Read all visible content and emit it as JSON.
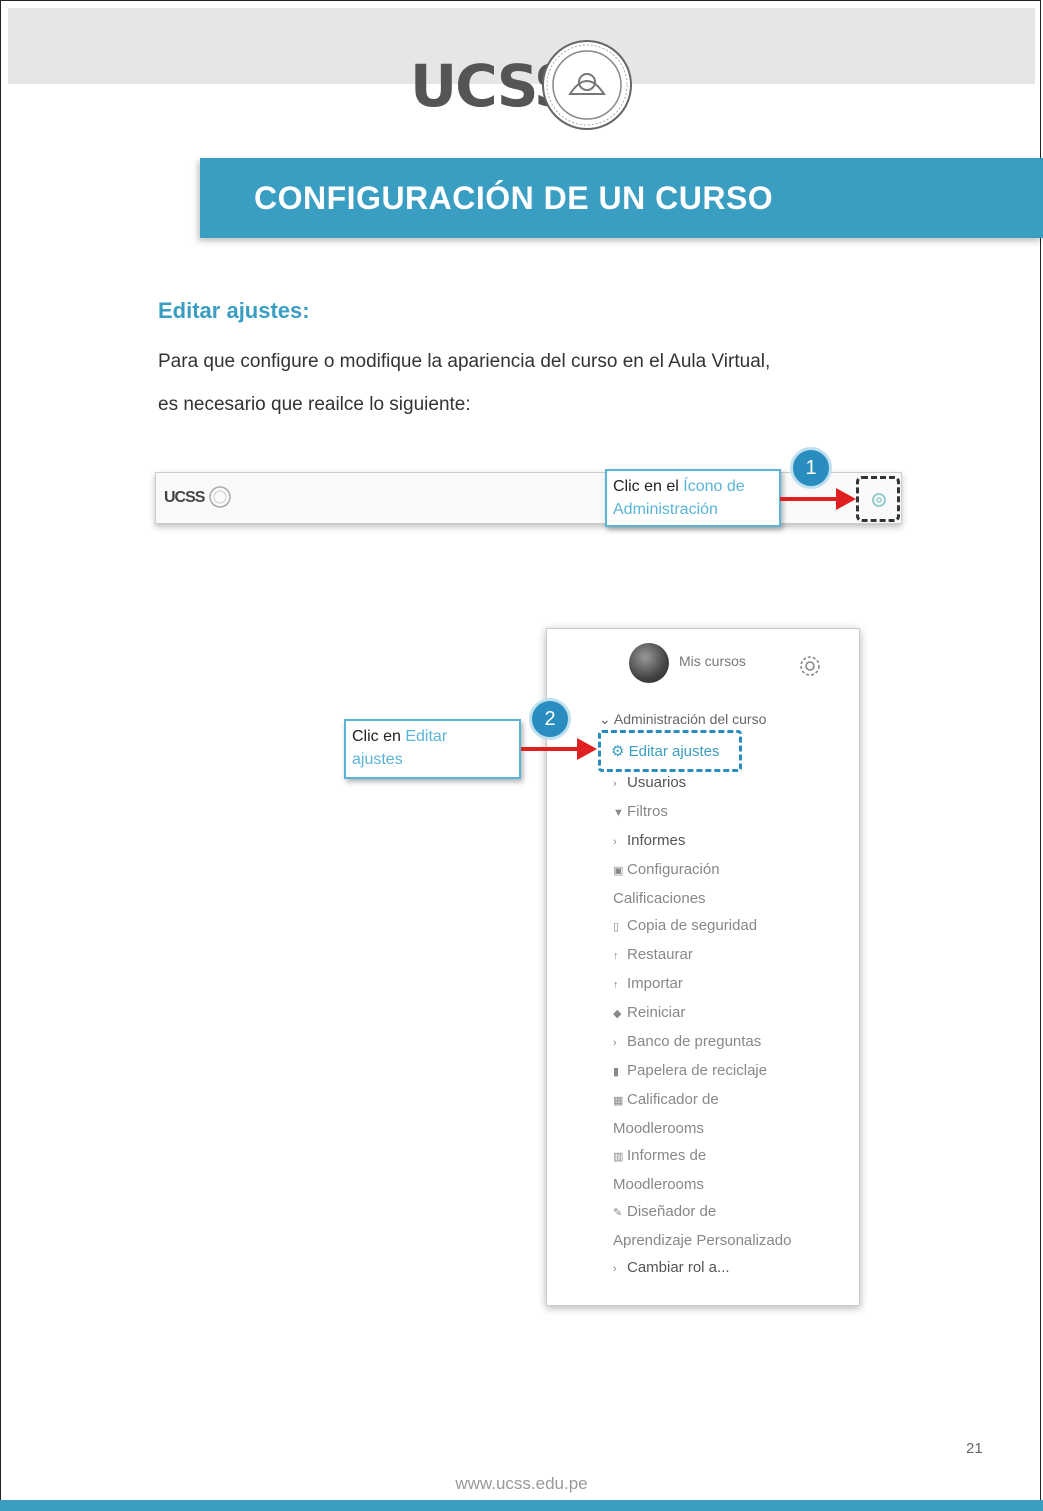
{
  "logo": {
    "text": "UCSS"
  },
  "banner": {
    "title": "CONFIGURACIÓN DE UN CURSO"
  },
  "section": {
    "heading": "Editar ajustes:",
    "line1": "Para que configure o modifique la apariencia del curso en el Aula Virtual,",
    "line2": "es necesario que reailce lo siguiente:"
  },
  "navbar": {
    "logo_text": "UCSS"
  },
  "step1": {
    "number": "1",
    "callout_prefix": "Clic en el",
    "callout_link_a": "Ícono de",
    "callout_link_b": "Administración"
  },
  "step2": {
    "number": "2",
    "callout_prefix": "Clic en",
    "callout_link_a": "Editar",
    "callout_link_b": "ajustes"
  },
  "menu": {
    "my_courses": "Mis cursos",
    "admin_header": "Administración del curso",
    "edit_settings": "Editar ajustes",
    "items": [
      "Usuarios",
      "Filtros",
      "Informes",
      "Configuración",
      "Calificaciones",
      "Copia de seguridad",
      "Restaurar",
      "Importar",
      "Reiniciar",
      "Banco de preguntas",
      "Papelera de reciclaje",
      "Calificador de",
      "Moodlerooms",
      "Informes de",
      "Moodlerooms",
      "Diseñador de",
      "Aprendizaje Personalizado",
      "Cambiar rol a..."
    ]
  },
  "footer": {
    "page_number": "21",
    "url": "www.ucss.edu.pe"
  },
  "colors": {
    "accent": "#3a9dc2",
    "arrow": "#e02020",
    "badge": "#2a8dbf"
  }
}
